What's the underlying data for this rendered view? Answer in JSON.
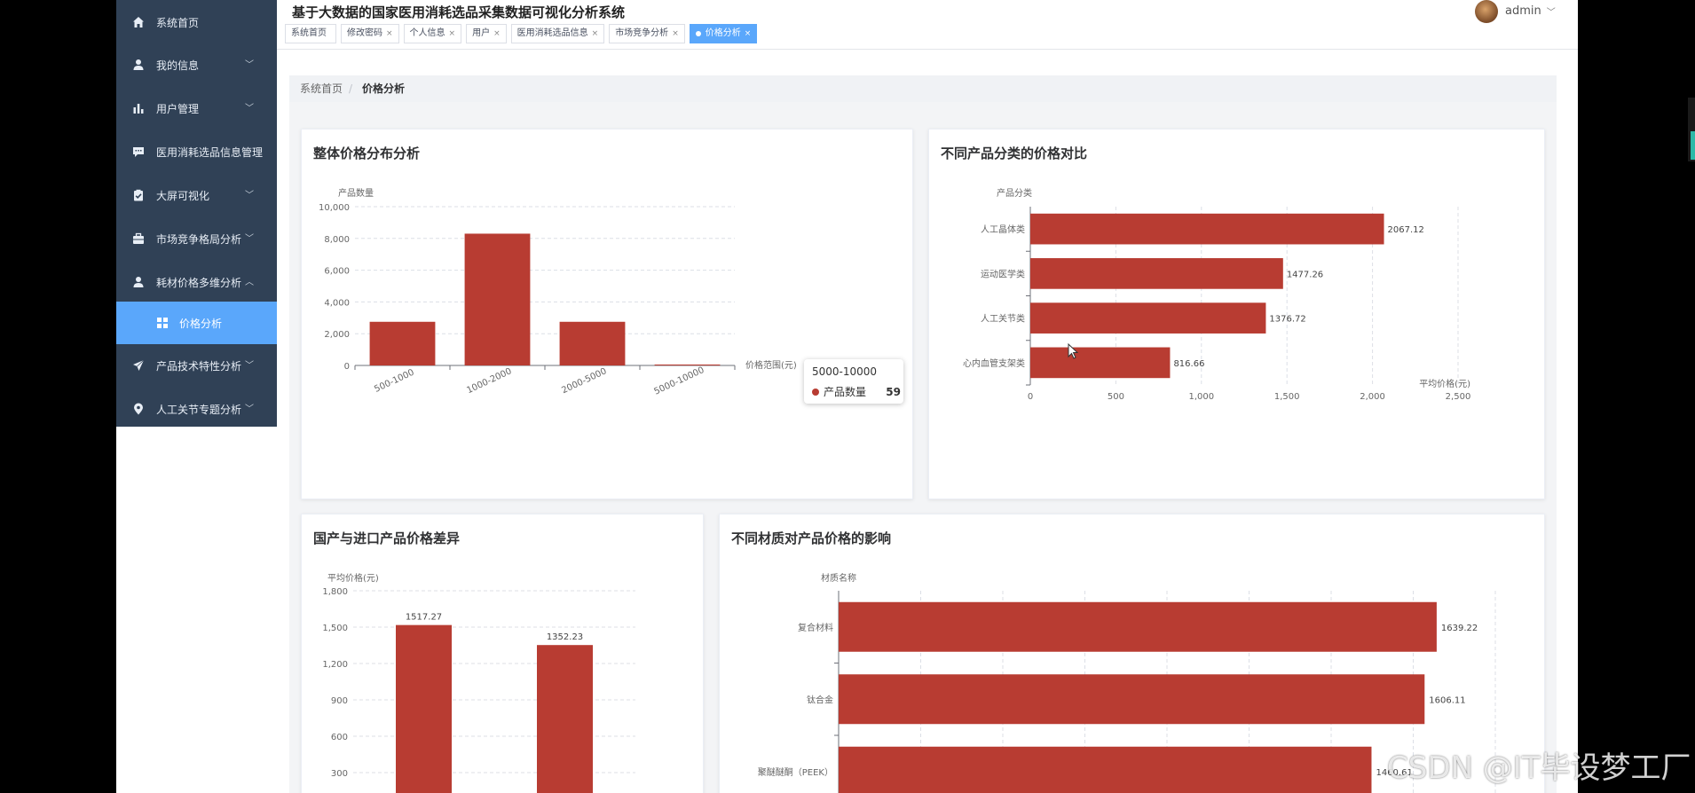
{
  "app": {
    "title": "基于大数据的国家医用消耗选品采集数据可视化分析系统",
    "user": "admin"
  },
  "sidebar": {
    "items": [
      {
        "label": "系统首页",
        "icon": "home-icon",
        "chevron": ""
      },
      {
        "label": "我的信息",
        "icon": "user-icon",
        "chevron": "﹀"
      },
      {
        "label": "用户管理",
        "icon": "bar-chart-icon",
        "chevron": "﹀"
      },
      {
        "label": "医用消耗选品信息管理",
        "icon": "message-icon",
        "chevron": ""
      },
      {
        "label": "大屏可视化",
        "icon": "clipboard-check-icon",
        "chevron": "﹀"
      },
      {
        "label": "市场竞争格局分析",
        "icon": "briefcase-icon",
        "chevron": "﹀"
      },
      {
        "label": "耗材价格多维分析",
        "icon": "user-icon",
        "chevron": "︿"
      },
      {
        "label": "价格分析",
        "icon": "grid-icon",
        "chevron": ""
      },
      {
        "label": "产品技术特性分析",
        "icon": "send-icon",
        "chevron": "﹀"
      },
      {
        "label": "人工关节专题分析",
        "icon": "location-icon",
        "chevron": "﹀"
      }
    ]
  },
  "tabs": [
    {
      "label": "系统首页",
      "close": ""
    },
    {
      "label": "修改密码",
      "close": "×"
    },
    {
      "label": "个人信息",
      "close": "×"
    },
    {
      "label": "用户",
      "close": "×"
    },
    {
      "label": "医用消耗选品信息",
      "close": "×"
    },
    {
      "label": "市场竞争分析",
      "close": "×"
    },
    {
      "label": "价格分析",
      "close": "×"
    }
  ],
  "breadcrumb": {
    "home": "系统首页",
    "sep": "/",
    "current": "价格分析"
  },
  "cards": {
    "c1": {
      "title": "整体价格分布分析"
    },
    "c2": {
      "title": "不同产品分类的价格对比"
    },
    "c3": {
      "title": "国产与进口产品价格差异"
    },
    "c4": {
      "title": "不同材质对产品价格的影响"
    }
  },
  "tooltip": {
    "title": "5000-10000",
    "series": "产品数量",
    "value": "59"
  },
  "watermark": "CSDN @IT毕设梦工厂",
  "colors": {
    "bar": "#b83c32",
    "accent": "#5aa7fb",
    "sidebar": "#304156"
  },
  "chart_data": [
    {
      "type": "bar",
      "title": "整体价格分布分析",
      "ylabel": "产品数量",
      "xlabel": "价格范围(元)",
      "categories": [
        "500-1000",
        "1000-2000",
        "2000-5000",
        "5000-10000"
      ],
      "values": [
        2750,
        8300,
        2750,
        59
      ],
      "ylim": [
        0,
        10000
      ],
      "yticks": [
        0,
        2000,
        4000,
        6000,
        8000,
        10000
      ],
      "ytick_labels": [
        "0",
        "2,000",
        "4,000",
        "6,000",
        "8,000",
        "10,000"
      ]
    },
    {
      "type": "bar",
      "orientation": "horizontal",
      "title": "不同产品分类的价格对比",
      "ylabel": "产品分类",
      "xlabel": "平均价格(元)",
      "categories": [
        "人工晶体类",
        "运动医学类",
        "人工关节类",
        "心内血管支架类"
      ],
      "values": [
        2067.12,
        1477.26,
        1376.72,
        816.66
      ],
      "value_labels": [
        "2067.12",
        "1477.26",
        "1376.72",
        "816.66"
      ],
      "xlim": [
        0,
        2500
      ],
      "xticks": [
        0,
        500,
        1000,
        1500,
        2000,
        2500
      ],
      "xtick_labels": [
        "0",
        "500",
        "1,000",
        "1,500",
        "2,000",
        "2,500"
      ]
    },
    {
      "type": "bar",
      "title": "国产与进口产品价格差异",
      "ylabel": "平均价格(元)",
      "categories": [
        "",
        ""
      ],
      "values": [
        1517.27,
        1352.23
      ],
      "value_labels": [
        "1517.27",
        "1352.23"
      ],
      "ylim": [
        0,
        1800
      ],
      "yticks": [
        300,
        600,
        900,
        1200,
        1500,
        1800
      ],
      "ytick_labels": [
        "300",
        "600",
        "900",
        "1,200",
        "1,500",
        "1,800"
      ]
    },
    {
      "type": "bar",
      "orientation": "horizontal",
      "title": "不同材质对产品价格的影响",
      "ylabel": "材质名称",
      "categories": [
        "复合材料",
        "钛合金",
        "聚醚醚酮（PEEK）"
      ],
      "values": [
        1639.22,
        1606.11,
        1460.61
      ],
      "value_labels": [
        "1639.22",
        "1606.11",
        "1460.61"
      ],
      "xlim": [
        0,
        1800
      ]
    }
  ]
}
